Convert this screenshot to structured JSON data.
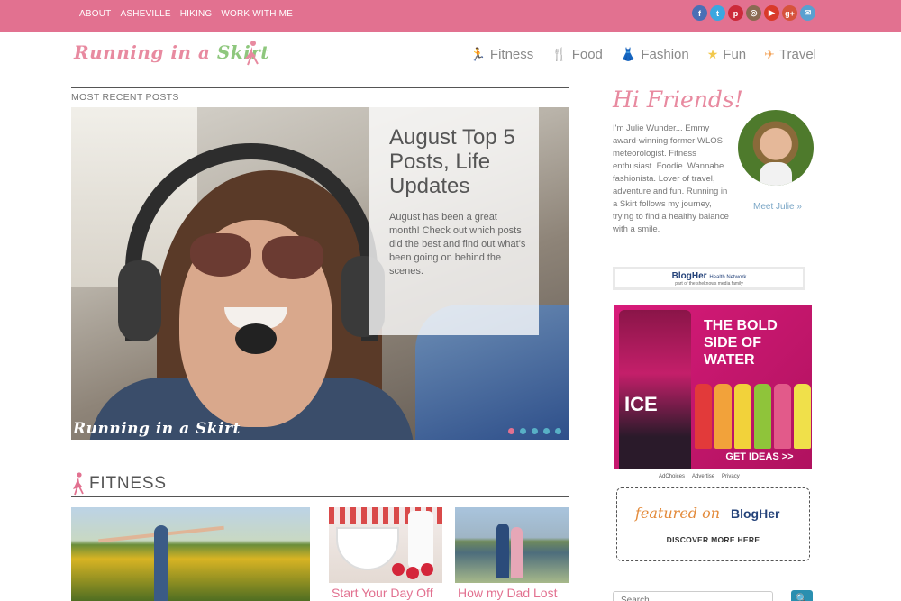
{
  "topnav": [
    "ABOUT",
    "ASHEVILLE",
    "HIKING",
    "WORK WITH ME"
  ],
  "social": [
    {
      "icon": "facebook-icon",
      "glyph": "f",
      "color": "#4a6fb5"
    },
    {
      "icon": "twitter-icon",
      "glyph": "t",
      "color": "#3aa7e0"
    },
    {
      "icon": "pinterest-icon",
      "glyph": "p",
      "color": "#cc2a3a"
    },
    {
      "icon": "instagram-icon",
      "glyph": "◎",
      "color": "#8a6a52"
    },
    {
      "icon": "youtube-icon",
      "glyph": "▶",
      "color": "#d93a2a"
    },
    {
      "icon": "google-plus-icon",
      "glyph": "g+",
      "color": "#d6533c"
    },
    {
      "icon": "email-icon",
      "glyph": "✉",
      "color": "#5aa0d0"
    }
  ],
  "logo": {
    "part1": "Running in a ",
    "part2": "Skirt"
  },
  "mainnav": [
    {
      "label": "Fitness",
      "icon": "runner-icon",
      "glyph": "🏃",
      "color": "#e27190"
    },
    {
      "label": "Food",
      "icon": "utensils-icon",
      "glyph": "🍴",
      "color": "#8ec77d"
    },
    {
      "label": "Fashion",
      "icon": "dress-icon",
      "glyph": "👗",
      "color": "#58b0c6"
    },
    {
      "label": "Fun",
      "icon": "star-icon",
      "glyph": "★",
      "color": "#f2c84b"
    },
    {
      "label": "Travel",
      "icon": "plane-icon",
      "glyph": "✈",
      "color": "#f3a35a"
    }
  ],
  "recent": {
    "label": "MOST RECENT POSTS",
    "title": "August Top 5 Posts, Life Updates",
    "excerpt": "August has been a great month! Check out which posts did the best and find out what's been going on behind the scenes.",
    "watermark": "Running in a Skirt"
  },
  "fitness": {
    "heading": "FITNESS",
    "posts": [
      "Start Your Day Off",
      "How my Dad Lost"
    ]
  },
  "sidebar": {
    "greeting": "Hi Friends!",
    "bio": "I'm Julie Wunder... Emmy award-winning former WLOS meteorologist. Fitness enthusiast. Foodie. Wannabe fashionista. Lover of travel, adventure and fun. Running in a Skirt follows my journey, trying to find a healthy balance with a smile.",
    "meet": "Meet Julie »",
    "blogher_bar": {
      "brand": "BlogHer",
      "tag": "Health Network",
      "sub": "part of the sheknows media family"
    },
    "ad": {
      "headline": "THE BOLD SIDE OF WATER",
      "product": "ICE",
      "cta": "GET IDEAS >>",
      "footer": [
        "AdChoices",
        "Advertise",
        "Privacy"
      ]
    },
    "featured": {
      "script": "featured on",
      "brand": "BlogHer",
      "cta": "DISCOVER MORE HERE"
    },
    "search_placeholder": "Search",
    "search_button": "🔍"
  },
  "colors": {
    "brand_pink": "#e27190",
    "accent_green": "#8ec77d",
    "link_blue": "#7aa6c6"
  }
}
